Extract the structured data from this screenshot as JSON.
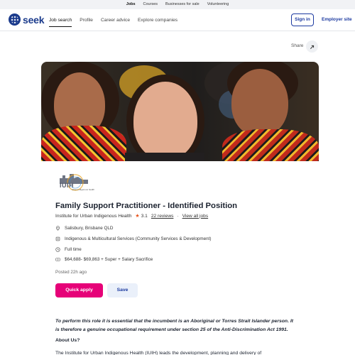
{
  "topstrip": {
    "items": [
      "Jobs",
      "Courses",
      "Businesses for sale",
      "Volunteering"
    ],
    "active_index": 0
  },
  "header": {
    "brand": "seek",
    "nav": [
      "Job search",
      "Profile",
      "Career advice",
      "Explore companies"
    ],
    "sign_in": "Sign in",
    "employer": "Employer site"
  },
  "share": {
    "label": "Share"
  },
  "job": {
    "logo_text": "IUIH",
    "logo_subtext": "urban indigenous health",
    "title": "Family Support Practitioner - Identified Position",
    "company": "Institute for Urban Indigenous Health",
    "rating": "3.1",
    "reviews": "22 reviews",
    "view_all": "View all jobs",
    "location": "Salisbury, Brisbane QLD",
    "category": "Indigenous & Multicultural Services (Community Services & Development)",
    "work_type": "Full time",
    "salary": "$64,688- $69,863 + Super + Salary Sacrifice",
    "posted": "Posted 22h ago",
    "quick_apply": "Quick apply",
    "save": "Save"
  },
  "description": {
    "intro": "To perform this role it is essential that the incumbent is an Aboriginal or Torres Strait Islander person. It is therefore a genuine occupational requirement under section 25 of the Anti-Discrimination Act 1991.",
    "about_heading": "About Us?",
    "about_text": "The Institute for Urban Indigenous Health (IUIH) leads the development, planning and delivery of"
  },
  "colors": {
    "brand_blue": "#1c3aa0",
    "apply_pink": "#e60278",
    "star": "#e8541c"
  }
}
